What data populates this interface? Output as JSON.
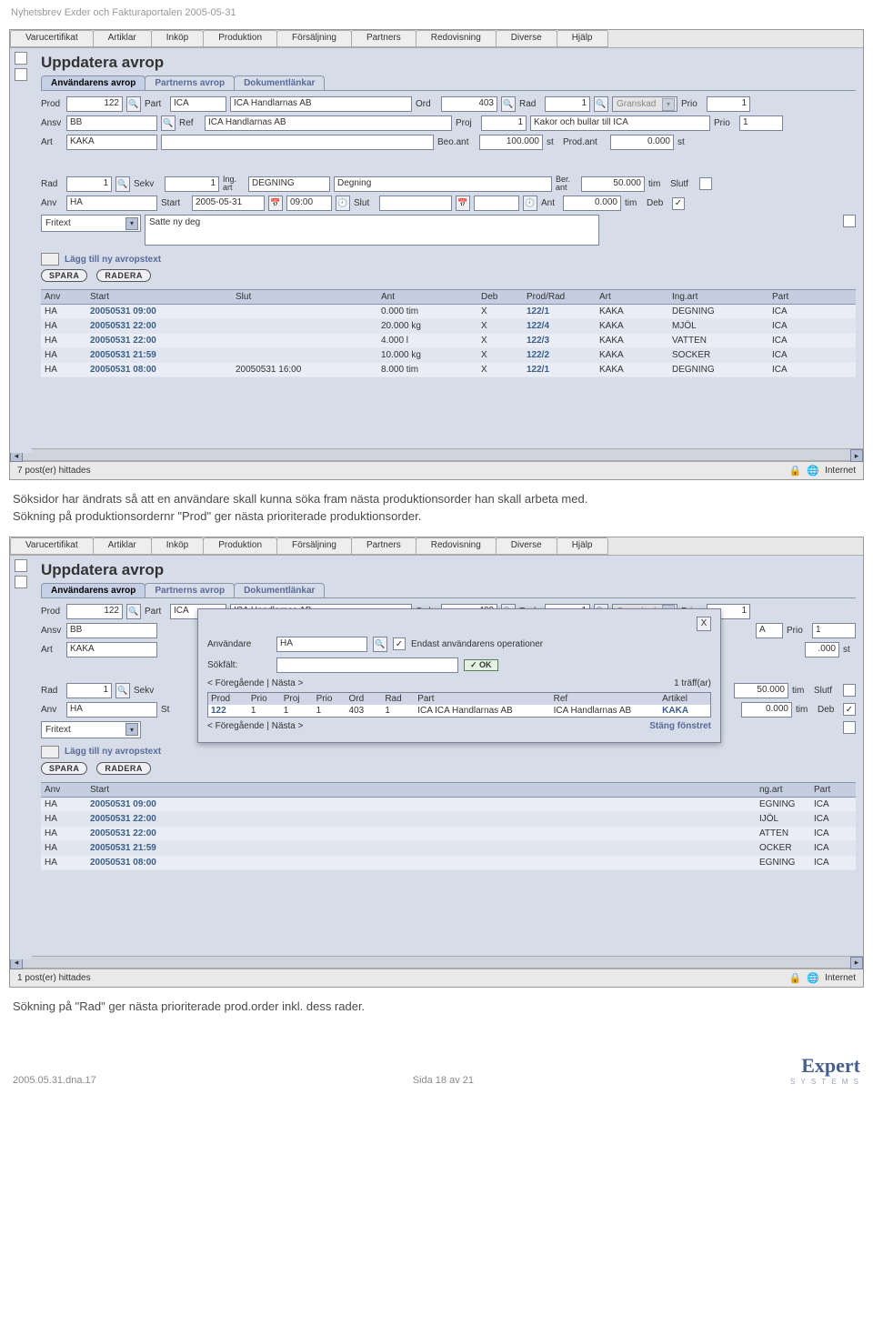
{
  "doc_header": "Nyhetsbrev Exder och Fakturaportalen 2005-05-31",
  "menubar": [
    "Varucertifikat",
    "Artiklar",
    "Inköp",
    "Produktion",
    "Försäljning",
    "Partners",
    "Redovisning",
    "Diverse",
    "Hjälp"
  ],
  "page_title": "Uppdatera avrop",
  "subtabs": [
    {
      "label": "Användarens avrop",
      "active": true
    },
    {
      "label": "Partnerns avrop",
      "active": false
    },
    {
      "label": "Dokumentlänkar",
      "active": false
    }
  ],
  "row1": {
    "prod_lbl": "Prod",
    "prod": "122",
    "part_lbl": "Part",
    "part_code": "ICA",
    "part_name": "ICA Handlarnas AB",
    "ord_lbl": "Ord",
    "ord": "403",
    "rad_lbl": "Rad",
    "rad": "1",
    "granskad_lbl": "Granskad",
    "prio_lbl": "Prio",
    "prio": "1"
  },
  "row2": {
    "ansv_lbl": "Ansv",
    "ansv": "BB",
    "ref_lbl": "Ref",
    "ref": "ICA Handlarnas AB",
    "proj_lbl": "Proj",
    "proj": "1",
    "proj_desc": "Kakor och bullar till ICA",
    "prio2_lbl": "Prio",
    "prio2": "1"
  },
  "row3": {
    "art_lbl": "Art",
    "art": "KAKA",
    "beo_lbl": "Beo.ant",
    "beo": "100.000",
    "beo_unit": "st",
    "prodant_lbl": "Prod.ant",
    "prodant": "0.000",
    "prodant_unit": "st"
  },
  "row4": {
    "rad_lbl": "Rad",
    "rad": "1",
    "sekv_lbl": "Sekv",
    "sekv": "1",
    "ingart_lbl": "Ing.\nart",
    "ingart": "DEGNING",
    "ingart_desc": "Degning",
    "berant_lbl": "Ber.\nant",
    "berant": "50.000",
    "berant_unit": "tim",
    "slutf_lbl": "Slutf"
  },
  "row5": {
    "anv_lbl": "Anv",
    "anv": "HA",
    "start_lbl": "Start",
    "start_date": "2005-05-31",
    "start_time": "09:00",
    "slut_lbl": "Slut",
    "ant_lbl": "Ant",
    "ant": "0.000",
    "ant_unit": "tim",
    "deb_lbl": "Deb"
  },
  "row6": {
    "dropdown": "Fritext",
    "free_text": "Satte ny deg"
  },
  "add_text_link": "Lägg till ny avropstext",
  "btn_save": "SPARA",
  "btn_delete": "RADERA",
  "table_headers": [
    "Anv",
    "Start",
    "Slut",
    "Ant",
    "Deb",
    "Prod/Rad",
    "Art",
    "Ing.art",
    "Part"
  ],
  "table_rows": [
    {
      "anv": "HA",
      "start": "20050531 09:00",
      "slut": "",
      "ant": "0.000 tim",
      "deb": "X",
      "pr": "122/1",
      "art": "KAKA",
      "ing": "DEGNING",
      "part": "ICA"
    },
    {
      "anv": "HA",
      "start": "20050531 22:00",
      "slut": "",
      "ant": "20.000 kg",
      "deb": "X",
      "pr": "122/4",
      "art": "KAKA",
      "ing": "MJÖL",
      "part": "ICA"
    },
    {
      "anv": "HA",
      "start": "20050531 22:00",
      "slut": "",
      "ant": "4.000 l",
      "deb": "X",
      "pr": "122/3",
      "art": "KAKA",
      "ing": "VATTEN",
      "part": "ICA"
    },
    {
      "anv": "HA",
      "start": "20050531 21:59",
      "slut": "",
      "ant": "10.000 kg",
      "deb": "X",
      "pr": "122/2",
      "art": "KAKA",
      "ing": "SOCKER",
      "part": "ICA"
    },
    {
      "anv": "HA",
      "start": "20050531 08:00",
      "slut": "20050531 16:00",
      "ant": "8.000 tim",
      "deb": "X",
      "pr": "122/1",
      "art": "KAKA",
      "ing": "DEGNING",
      "part": "ICA"
    }
  ],
  "status1": "7 post(er) hittades",
  "status2": "1 post(er) hittades",
  "internet": "Internet",
  "para1": "Söksidor har ändrats så att en användare skall kunna söka fram nästa produktionsorder han skall arbeta med.\nSökning på produktionsordernr \"Prod\" ger nästa prioriterade produktionsorder.",
  "para2": "Sökning på \"Rad\" ger nästa prioriterade prod.order inkl. dess rader.",
  "s2_t2_rows": [
    {
      "anv": "HA",
      "start": "20050531 09:00",
      "ing": "EGNING",
      "part": "ICA"
    },
    {
      "anv": "HA",
      "start": "20050531 22:00",
      "ing": "IJÖL",
      "part": "ICA"
    },
    {
      "anv": "HA",
      "start": "20050531 22:00",
      "ing": "ATTEN",
      "part": "ICA"
    },
    {
      "anv": "HA",
      "start": "20050531 21:59",
      "ing": "OCKER",
      "part": "ICA"
    },
    {
      "anv": "HA",
      "start": "20050531 08:00",
      "ing": "EGNING",
      "part": "ICA"
    }
  ],
  "s2_t2_head": {
    "anv": "Anv",
    "start": "Start",
    "ing": "ng.art",
    "part": "Part"
  },
  "overlay": {
    "anvandare_lbl": "Användare",
    "anvandare": "HA",
    "endast": "Endast användarens operationer",
    "sokfalt_lbl": "Sökfält:",
    "ok": "OK",
    "prev": "< Föregående",
    "next": "Nästa >",
    "hits": "1 träff(ar)",
    "head": [
      "Prod",
      "Prio",
      "Proj",
      "Prio",
      "Ord",
      "Rad",
      "Part",
      "Ref",
      "Artikel"
    ],
    "row": [
      "122",
      "1",
      "1",
      "1",
      "403",
      "1",
      "ICA ICA Handlarnas AB",
      "ICA Handlarnas AB",
      "KAKA"
    ],
    "close": "Stäng fönstret",
    "x": "X"
  },
  "s2_row5_st": "St",
  "s2_r1_right": {
    "a": "A",
    "prio": "Prio",
    "prio_v": "1"
  },
  "s2_r3_right": {
    "val": ".000",
    "unit": "st"
  },
  "s2_r4_right": {
    "val": "50.000",
    "unit": "tim",
    "slutf": "Slutf"
  },
  "s2_r5_right": {
    "val": "0.000",
    "unit": "tim",
    "deb": "Deb"
  },
  "footer_left": "2005.05.31.dna.17",
  "footer_mid": "Sida 18 av 21",
  "logo_big": "Expert",
  "logo_sub": "S Y S T E M S"
}
